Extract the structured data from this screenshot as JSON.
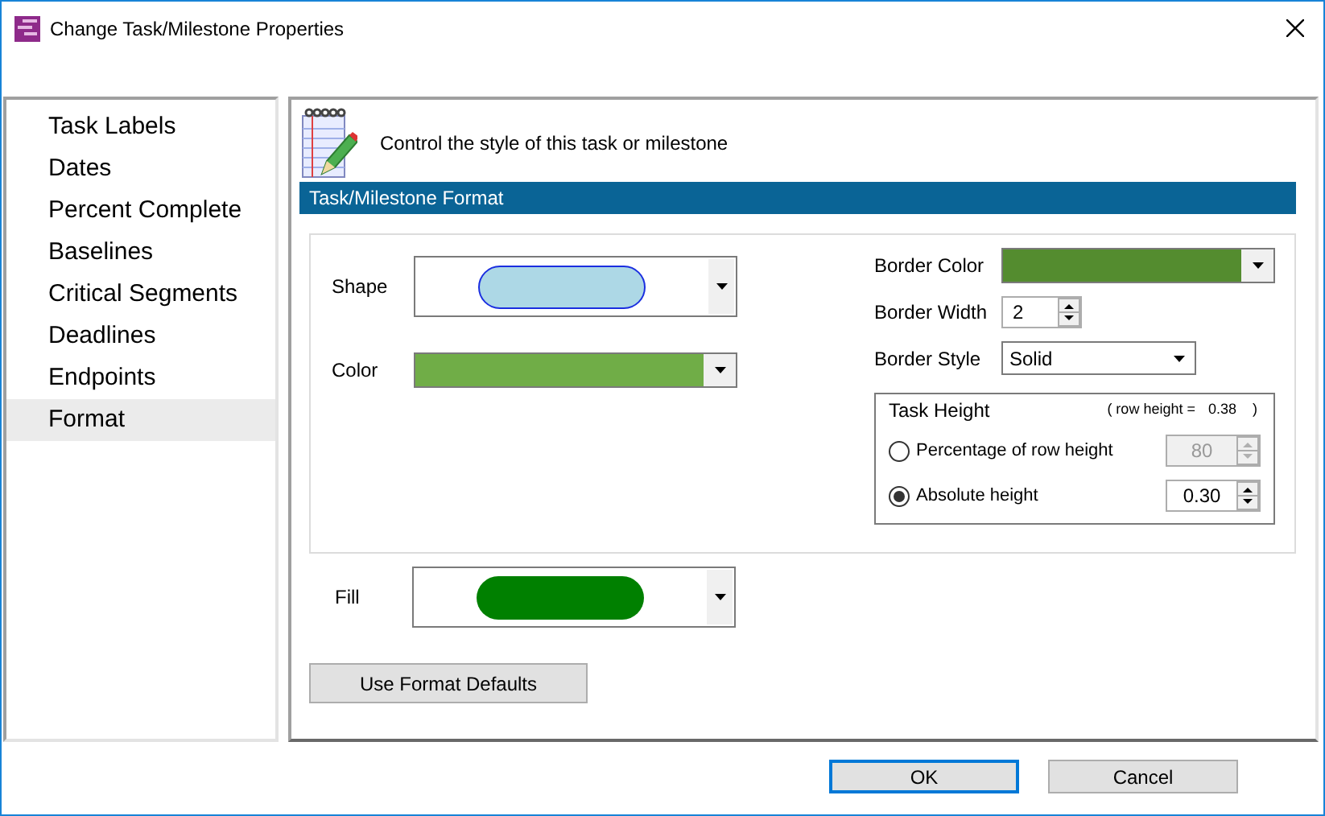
{
  "window": {
    "title": "Change Task/Milestone Properties"
  },
  "sidebar": {
    "items": [
      {
        "label": "Task Labels",
        "selected": false
      },
      {
        "label": "Dates",
        "selected": false
      },
      {
        "label": "Percent Complete",
        "selected": false
      },
      {
        "label": "Baselines",
        "selected": false
      },
      {
        "label": "Critical Segments",
        "selected": false
      },
      {
        "label": "Deadlines",
        "selected": false
      },
      {
        "label": "Endpoints",
        "selected": false
      },
      {
        "label": "Format",
        "selected": true
      }
    ]
  },
  "header": {
    "text": "Control the style of this task or milestone"
  },
  "section": {
    "title": "Task/Milestone Format"
  },
  "shape": {
    "label": "Shape",
    "color": "#add8e6"
  },
  "color": {
    "label": "Color",
    "color": "#70ad47"
  },
  "border_color": {
    "label": "Border Color",
    "color": "#548c2f"
  },
  "border_width": {
    "label": "Border Width",
    "value": "2"
  },
  "border_style": {
    "label": "Border Style",
    "value": "Solid"
  },
  "task_height": {
    "title": "Task Height",
    "row_height_label": "( row height =",
    "row_height_value": "0.38",
    "row_height_close": ")",
    "options": [
      {
        "label": "Percentage of row height",
        "selected": false,
        "value": "80",
        "disabled": true
      },
      {
        "label": "Absolute height",
        "selected": true,
        "value": "0.30",
        "disabled": false
      }
    ]
  },
  "fill": {
    "label": "Fill",
    "color": "#008000"
  },
  "defaults_button": "Use Format Defaults",
  "buttons": [
    {
      "label": "OK",
      "default": true
    },
    {
      "label": "Cancel",
      "default": false
    }
  ]
}
